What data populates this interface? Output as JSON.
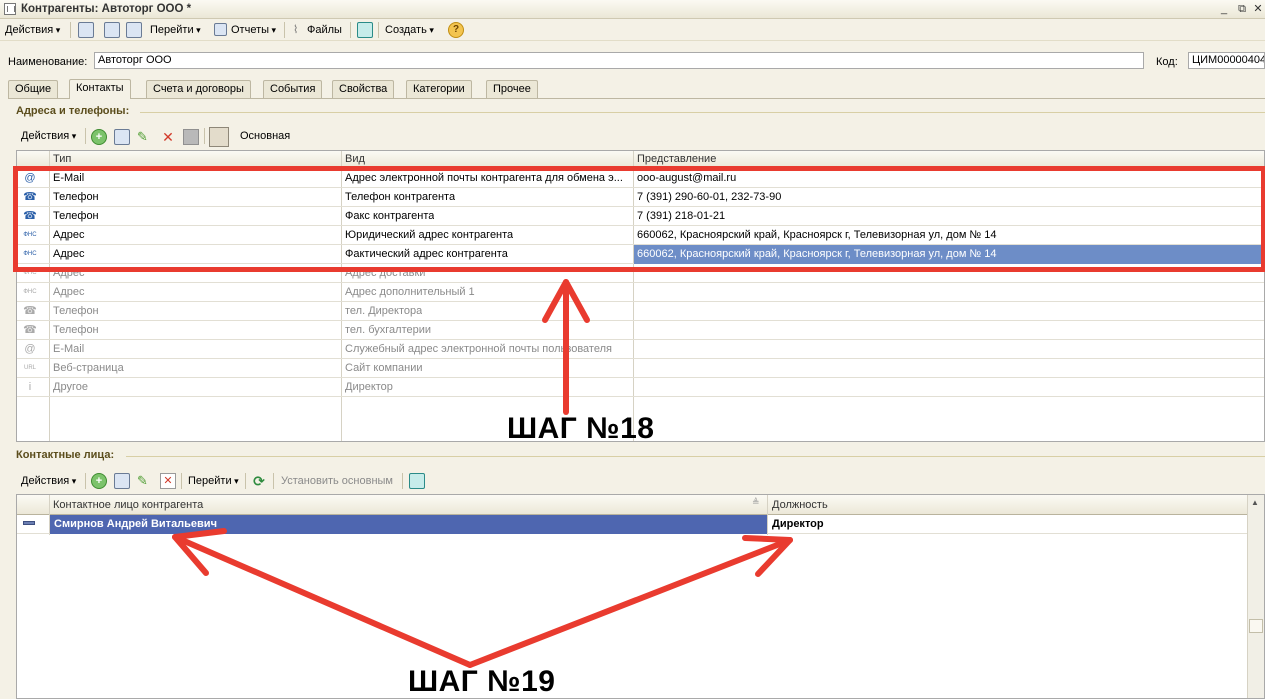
{
  "window": {
    "title": "Контрагенты: Автоторг ООО *",
    "btn_minimize": "_",
    "btn_restore": "⧉",
    "btn_close": "✕"
  },
  "toolbar": {
    "actions": "Действия",
    "goto": "Перейти",
    "reports": "Отчеты",
    "files": "Файлы",
    "create": "Создать",
    "help": "?"
  },
  "form": {
    "name_label": "Наименование:",
    "name_value": "Автоторг ООО",
    "code_label": "Код:",
    "code_value": "ЦИМ00000404"
  },
  "tabs": [
    "Общие",
    "Контакты",
    "Счета и договоры",
    "События",
    "Свойства",
    "Категории",
    "Прочее"
  ],
  "addresses": {
    "section_title": "Адреса и телефоны:",
    "toolbar": {
      "actions": "Действия",
      "main": "Основная"
    },
    "columns": [
      "Тип",
      "Вид",
      "Представление"
    ],
    "rows": [
      {
        "icon": "@",
        "type": "E-Mail",
        "kind": "Адрес электронной почты контрагента для обмена э...",
        "value": "ooo-august@mail.ru",
        "dim": false
      },
      {
        "icon": "☎",
        "type": "Телефон",
        "kind": "Телефон контрагента",
        "value": "7 (391) 290-60-01, 232-73-90",
        "dim": false
      },
      {
        "icon": "☎",
        "type": "Телефон",
        "kind": "Факс контрагента",
        "value": "7 (391) 218-01-21",
        "dim": false
      },
      {
        "icon": "ФНС",
        "type": "Адрес",
        "kind": "Юридический адрес контрагента",
        "value": "660062, Красноярский край, Красноярск г, Телевизорная ул, дом № 14",
        "dim": false
      },
      {
        "icon": "ФНС",
        "type": "Адрес",
        "kind": "Фактический адрес контрагента",
        "value": "660062, Красноярский край, Красноярск г, Телевизорная ул, дом № 14",
        "dim": false
      },
      {
        "icon": "ФНС",
        "type": "Адрес",
        "kind": "Адрес доставки",
        "value": "",
        "dim": true
      },
      {
        "icon": "ФНС",
        "type": "Адрес",
        "kind": "Адрес дополнительный 1",
        "value": "",
        "dim": true
      },
      {
        "icon": "☎",
        "type": "Телефон",
        "kind": "тел. Директора",
        "value": "",
        "dim": true
      },
      {
        "icon": "☎",
        "type": "Телефон",
        "kind": "тел. бухгалтерии",
        "value": "",
        "dim": true
      },
      {
        "icon": "@",
        "type": "E-Mail",
        "kind": "Служебный адрес электронной почты пользователя",
        "value": "",
        "dim": true
      },
      {
        "icon": "URL",
        "type": "Веб-страница",
        "kind": "Сайт компании",
        "value": "",
        "dim": true
      },
      {
        "icon": "i",
        "type": "Другое",
        "kind": "Директор",
        "value": "",
        "dim": true
      }
    ]
  },
  "contacts": {
    "section_title": "Контактные лица:",
    "toolbar": {
      "actions": "Действия",
      "goto": "Перейти",
      "set_main": "Установить основным"
    },
    "columns": [
      "Контактное лицо контрагента",
      "Должность"
    ],
    "rows": [
      {
        "name": "Смирнов Андрей Витальевич",
        "position": "Директор"
      }
    ]
  },
  "annotations": {
    "step18": "ШАГ №18",
    "step19": "ШАГ №19",
    "color": "#e93b2f"
  }
}
